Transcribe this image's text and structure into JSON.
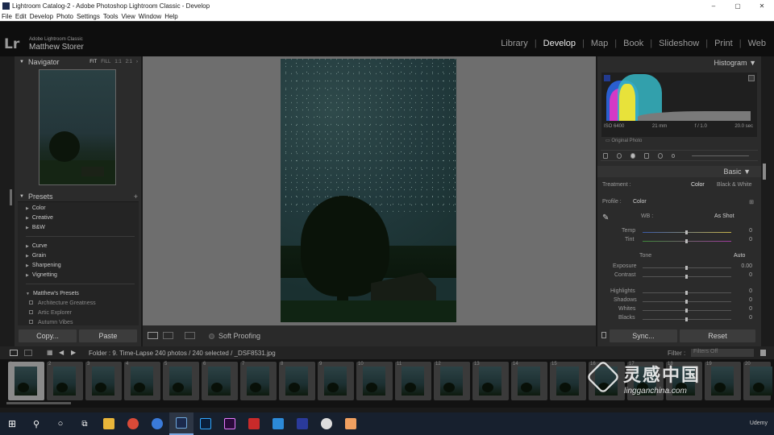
{
  "titlebar": {
    "title": "Lightroom Catalog-2 - Adobe Photoshop Lightroom Classic - Develop",
    "minimize": "–",
    "maximize": "▢",
    "close": "✕"
  },
  "menu": [
    "File",
    "Edit",
    "Develop",
    "Photo",
    "Settings",
    "Tools",
    "View",
    "Window",
    "Help"
  ],
  "identity": {
    "logo": "Lr",
    "product": "Adobe Lightroom Classic",
    "user": "Matthew Storer"
  },
  "modules": [
    "Library",
    "Develop",
    "Map",
    "Book",
    "Slideshow",
    "Print",
    "Web"
  ],
  "active_module": "Develop",
  "navigator": {
    "title": "Navigator",
    "zoom": [
      "FIT",
      "FILL",
      "1:1",
      "2:1"
    ]
  },
  "presets": {
    "title": "Presets",
    "groups1": [
      "Color",
      "Creative",
      "B&W"
    ],
    "groups2": [
      "Curve",
      "Grain",
      "Sharpening",
      "Vignetting"
    ],
    "user_group": "Matthew's Presets",
    "user_items": [
      "Architecture Greatness",
      "Artic Explorer",
      "Autumn Vibes"
    ]
  },
  "left_buttons": {
    "copy": "Copy...",
    "paste": "Paste"
  },
  "toolbar": {
    "soft_proofing": "Soft Proofing"
  },
  "histogram": {
    "title": "Histogram",
    "iso": "ISO 6400",
    "focal": "21 mm",
    "aperture": "f / 1.0",
    "shutter": "20.0 sec",
    "original": "Original Photo"
  },
  "basic": {
    "title": "Basic",
    "treatment_label": "Treatment :",
    "treatment_color": "Color",
    "treatment_bw": "Black & White",
    "profile_label": "Profile :",
    "profile_value": "Color",
    "wb_label": "WB :",
    "wb_value": "As Shot",
    "temp_label": "Temp",
    "temp_val": "0",
    "tint_label": "Tint",
    "tint_val": "0",
    "tone_label": "Tone",
    "auto_label": "Auto",
    "exposure_label": "Exposure",
    "exposure_val": "0.00",
    "contrast_label": "Contrast",
    "contrast_val": "0",
    "highlights_label": "Highlights",
    "highlights_val": "0",
    "shadows_label": "Shadows",
    "shadows_val": "0",
    "whites_label": "Whites",
    "whites_val": "0",
    "blacks_label": "Blacks",
    "blacks_val": "0"
  },
  "right_buttons": {
    "sync": "Sync...",
    "reset": "Reset"
  },
  "filmstrip": {
    "breadcrumb": "Folder : 9. Time-Lapse    240 photos / 240 selected / _DSF8531.jpg",
    "filter_label": "Filter :",
    "filter_value": "Filters Off",
    "numbers": [
      "1",
      "2",
      "3",
      "4",
      "5",
      "6",
      "7",
      "8",
      "9",
      "10",
      "11",
      "12",
      "13",
      "14",
      "15",
      "16",
      "17",
      "18",
      "19",
      "20"
    ]
  },
  "watermark": {
    "cn": "灵感中国",
    "en": "lingganchina.com"
  },
  "taskbar": {
    "udemy": "Udemy"
  }
}
